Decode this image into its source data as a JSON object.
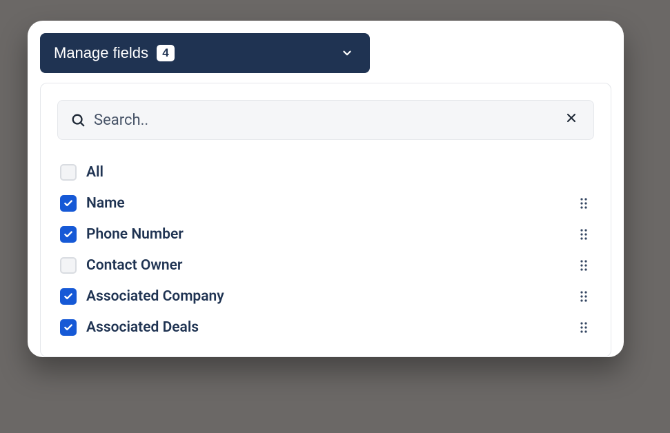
{
  "header": {
    "label": "Manage fields",
    "count": "4"
  },
  "search": {
    "placeholder": "Search..",
    "value": ""
  },
  "fields": {
    "all": {
      "label": "All",
      "checked": false
    },
    "items": [
      {
        "label": "Name",
        "checked": true
      },
      {
        "label": "Phone Number",
        "checked": true
      },
      {
        "label": "Contact Owner",
        "checked": false
      },
      {
        "label": "Associated Company",
        "checked": true
      },
      {
        "label": "Associated Deals",
        "checked": true
      }
    ]
  }
}
